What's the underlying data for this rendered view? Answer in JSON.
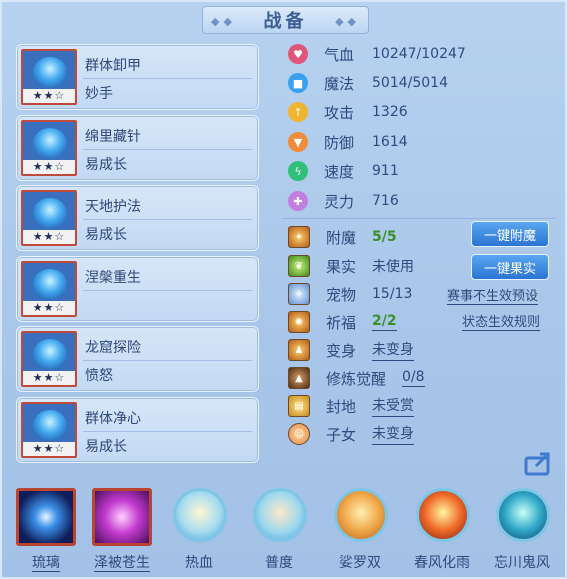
{
  "title": "战备",
  "skills": [
    {
      "name": "群体卸甲",
      "sub": "妙手",
      "stars": "★★☆"
    },
    {
      "name": "绵里藏针",
      "sub": "易成长",
      "stars": "★★☆"
    },
    {
      "name": "天地护法",
      "sub": "易成长",
      "stars": "★★☆"
    },
    {
      "name": "涅槃重生",
      "sub": "",
      "stars": "★★☆"
    },
    {
      "name": "龙窟探险",
      "sub": "愤怒",
      "stars": "★★☆"
    },
    {
      "name": "群体净心",
      "sub": "易成长",
      "stars": "★★☆"
    }
  ],
  "stats": [
    {
      "label": "气血",
      "value": "10247/10247",
      "icon": "heart-icon",
      "color": "#e0567a"
    },
    {
      "label": "魔法",
      "value": "5014/5014",
      "icon": "mana-icon",
      "color": "#3aa0ef"
    },
    {
      "label": "攻击",
      "value": "1326",
      "icon": "attack-icon",
      "color": "#f0b530"
    },
    {
      "label": "防御",
      "value": "1614",
      "icon": "defense-icon",
      "color": "#f08c3a"
    },
    {
      "label": "速度",
      "value": "911",
      "icon": "speed-icon",
      "color": "#2fbf7a"
    },
    {
      "label": "灵力",
      "value": "716",
      "icon": "spirit-icon",
      "color": "#c27fe0"
    }
  ],
  "rows": [
    {
      "label": "附魔",
      "value": "5/5"
    },
    {
      "label": "果实",
      "value": "未使用"
    },
    {
      "label": "宠物",
      "value": "15/13"
    },
    {
      "label": "祈福",
      "value": "2/2"
    },
    {
      "label": "变身",
      "value": "未变身"
    },
    {
      "label": "修炼觉醒",
      "value": "0/8"
    },
    {
      "label": "封地",
      "value": "未受赏"
    },
    {
      "label": "子女",
      "value": "未变身"
    }
  ],
  "buttons": {
    "enchant": "一键附魔",
    "fruit": "一键果实"
  },
  "links": {
    "match": "赛事不生效预设",
    "state": "状态生效规则"
  },
  "bottom": [
    "琉璃",
    "泽被苍生",
    "热血",
    "普度",
    "娑罗双",
    "春风化雨",
    "忘川鬼风"
  ]
}
